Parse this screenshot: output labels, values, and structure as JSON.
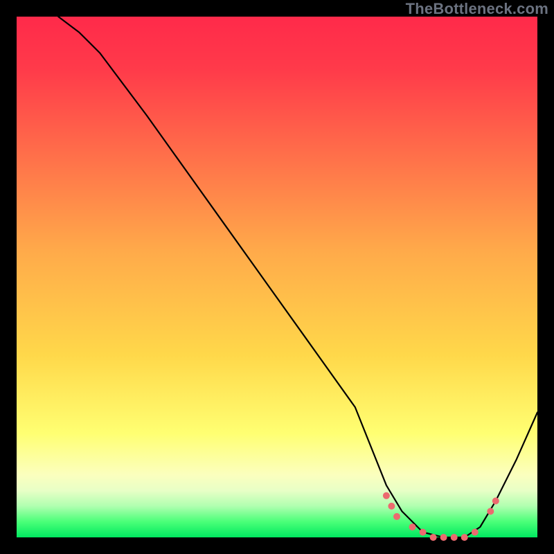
{
  "watermark": "TheBottleneck.com",
  "colors": {
    "background": "#000000",
    "curve": "#000000",
    "marker": "#ec6a6f",
    "gradient_top": "#ff2a4a",
    "gradient_bottom": "#00e860"
  },
  "chart_data": {
    "type": "line",
    "title": "",
    "xlabel": "",
    "ylabel": "",
    "xlim": [
      0,
      100
    ],
    "ylim": [
      0,
      100
    ],
    "grid": false,
    "legend": false,
    "notes": "V-shaped bottleneck curve on red-to-green vertical gradient. Y is inverted visually (high values at top of gradient = red / worse). Minimum basin spans roughly x≈71–88. Marker points cluster along the valley floor. Values are pixel-space estimates since no axis ticks are shown.",
    "series": [
      {
        "name": "bottleneck-curve",
        "x": [
          8,
          12,
          16,
          25,
          40,
          55,
          65,
          71,
          74,
          78,
          82,
          86,
          89,
          92,
          96,
          100
        ],
        "y": [
          100,
          97,
          93,
          81,
          60,
          39,
          25,
          10,
          5,
          1,
          0,
          0,
          2,
          7,
          15,
          24
        ]
      }
    ],
    "markers": {
      "name": "valley-cluster",
      "x": [
        71,
        72,
        73,
        76,
        78,
        80,
        82,
        84,
        86,
        88,
        91,
        92
      ],
      "y": [
        8,
        6,
        4,
        2,
        1,
        0,
        0,
        0,
        0,
        1,
        5,
        7
      ]
    }
  }
}
